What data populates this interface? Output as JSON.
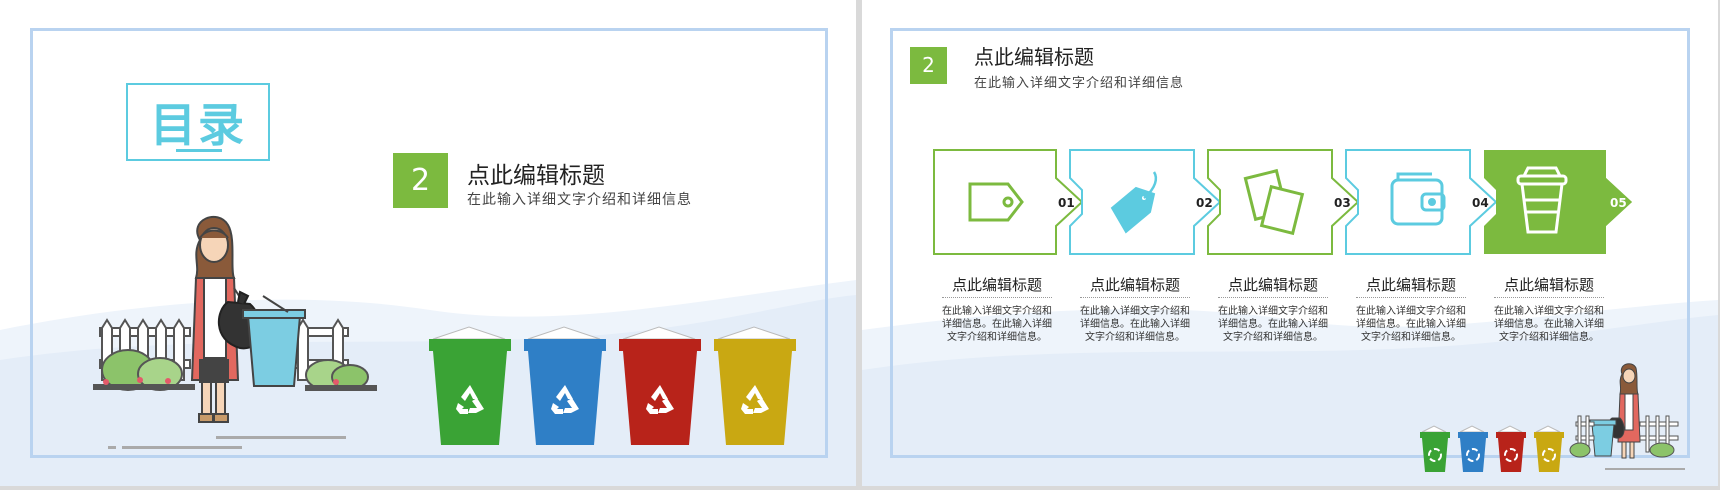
{
  "left_slide": {
    "toc_title": "目录",
    "number": "2",
    "title": "点此编辑标题",
    "description": "在此输入详细文字介绍和详细信息"
  },
  "right_slide": {
    "number": "2",
    "title": "点此编辑标题",
    "description": "在此输入详细文字介绍和详细信息",
    "steps": [
      {
        "label": "01",
        "icon": "tag-icon",
        "col_title": "点此编辑标题",
        "col_desc": "在此输入详细文字介绍和详细信息。在此输入详细文字介绍和详细信息。"
      },
      {
        "label": "02",
        "icon": "price-tag-icon",
        "col_title": "点此编辑标题",
        "col_desc": "在此输入详细文字介绍和详细信息。在此输入详细文字介绍和详细信息。"
      },
      {
        "label": "03",
        "icon": "cards-icon",
        "col_title": "点此编辑标题",
        "col_desc": "在此输入详细文字介绍和详细信息。在此输入详细文字介绍和详细信息。"
      },
      {
        "label": "04",
        "icon": "wallet-icon",
        "col_title": "点此编辑标题",
        "col_desc": "在此输入详细文字介绍和详细信息。在此输入详细文字介绍和详细信息。"
      },
      {
        "label": "05",
        "icon": "cup-icon",
        "col_title": "点此编辑标题",
        "col_desc": "在此输入详细文字介绍和详细信息。在此输入详细文字介绍和详细信息。"
      }
    ]
  },
  "colors": {
    "green": "#7cba3f",
    "cyan": "#5ccbe0",
    "frame": "#b9d3f0",
    "bin_green": "#3aa335",
    "bin_blue": "#2f7fc6",
    "bin_red": "#b8231a",
    "bin_yellow": "#c9a812"
  }
}
